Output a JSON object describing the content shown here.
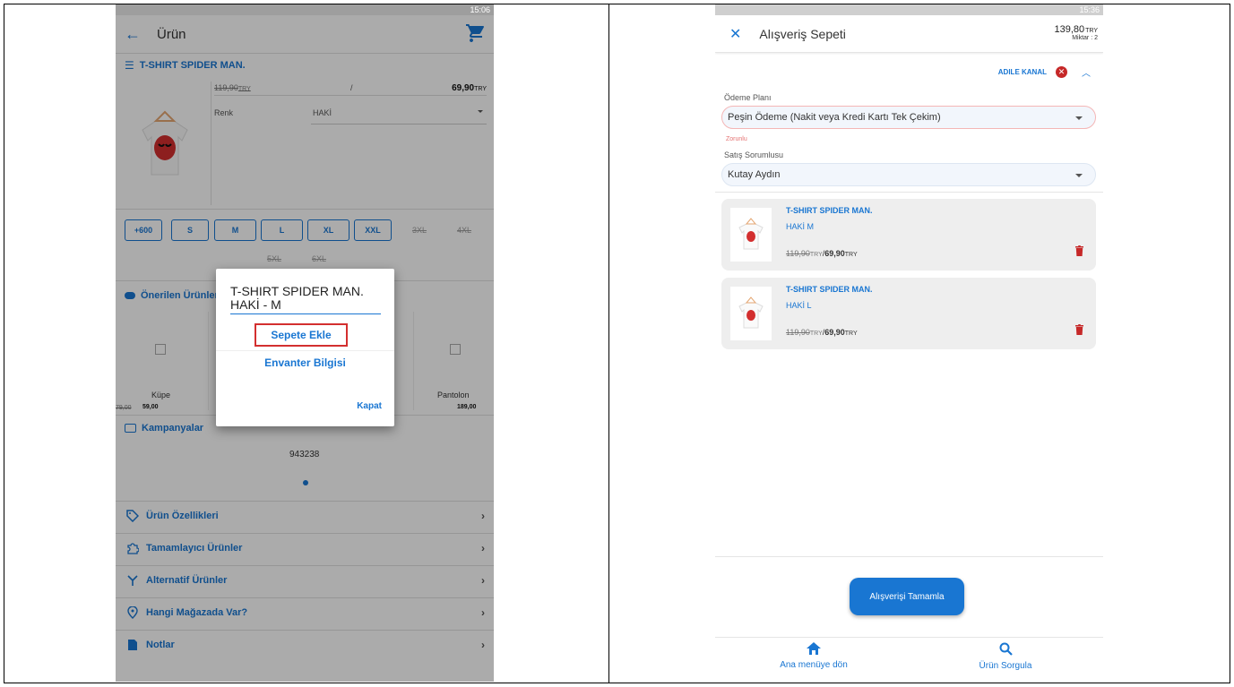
{
  "left": {
    "status_time": "15:06",
    "app_title": "Ürün",
    "product_title": "T-SHIRT SPIDER MAN.",
    "old_price": "119,90",
    "currency": "TRY",
    "separator": "/",
    "new_price": "69,90",
    "color_label": "Renk",
    "color_value": "HAKİ",
    "sizes": [
      "+600",
      "S",
      "M",
      "L",
      "XL",
      "XXL",
      "3XL",
      "4XL",
      "5XL",
      "6XL"
    ],
    "suggested_title": "Önerilen Ürünler",
    "suggested_items": [
      {
        "name": "Küpe",
        "old": "79,00",
        "new": "59,00"
      },
      {
        "name": "Pantolon",
        "new": "189,00"
      }
    ],
    "campaigns_title": "Kampanyalar",
    "campaign_code": "943238",
    "menu": [
      "Ürün Özellikleri",
      "Tamamlayıcı Ürünler",
      "Alternatif Ürünler",
      "Hangi Mağazada Var?",
      "Notlar"
    ],
    "dialog": {
      "title_line1": "T-SHIRT SPIDER MAN.",
      "title_line2": "HAKİ - M",
      "add_to_cart": "Sepete Ekle",
      "inventory": "Envanter Bilgisi",
      "close": "Kapat"
    }
  },
  "right": {
    "status_time": "15:36",
    "app_title": "Alışveriş Sepeti",
    "total": "139,80",
    "currency": "TRY",
    "quantity": "Miktar : 2",
    "channel": "ADILE KANAL",
    "payment_label": "Ödeme Planı",
    "payment_value": "Peşin Ödeme (Nakit veya Kredi Kartı Tek Çekim)",
    "required_text": "Zorunlu",
    "sales_label": "Satış Sorumlusu",
    "sales_value": "Kutay Aydın",
    "items": [
      {
        "name": "T-SHIRT SPIDER MAN.",
        "variant": "HAKİ M",
        "old": "119,90",
        "new": "69,90"
      },
      {
        "name": "T-SHIRT SPIDER MAN.",
        "variant": "HAKİ L",
        "old": "119,90",
        "new": "69,90"
      }
    ],
    "complete_button": "Alışverişi Tamamla",
    "nav_home": "Ana menüye dön",
    "nav_search": "Ürün Sorgula"
  },
  "colors": {
    "primary": "#1976d2",
    "delete": "#c62828",
    "highlight_border": "#d32f2f"
  }
}
